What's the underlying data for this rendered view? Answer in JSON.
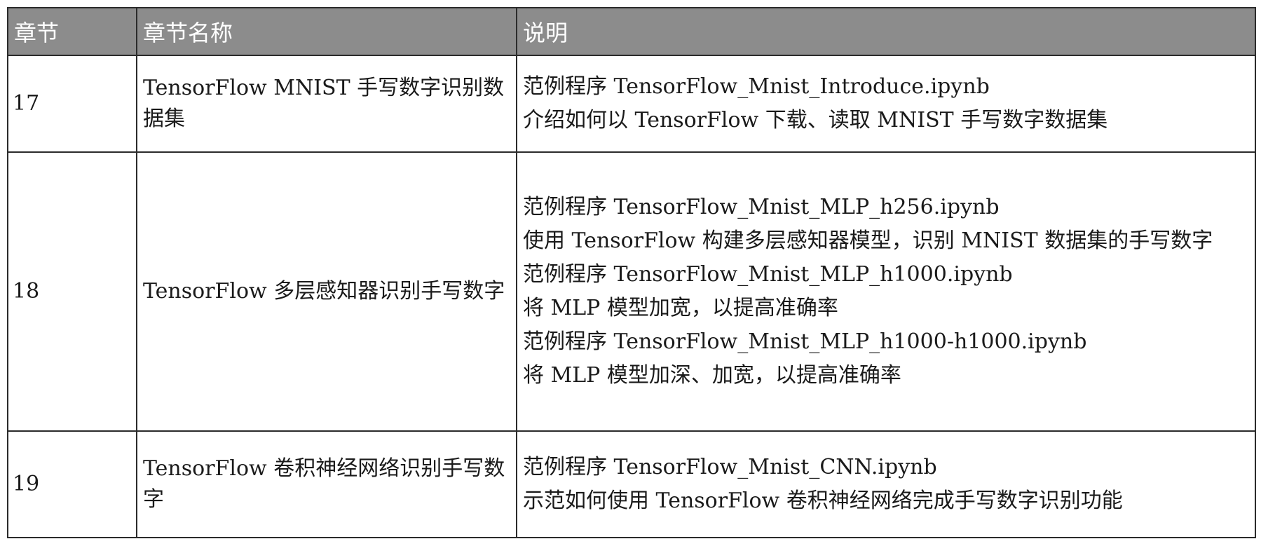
{
  "table": {
    "headers": [
      "章节",
      "章节名称",
      "说明"
    ],
    "rows": [
      {
        "chapter": "17",
        "name": "TensorFlow MNIST 手写数字识别数据集",
        "description": [
          "范例程序 TensorFlow_Mnist_Introduce.ipynb",
          "介绍如何以 TensorFlow 下载、读取 MNIST 手写数字数据集"
        ]
      },
      {
        "chapter": "18",
        "name": "TensorFlow 多层感知器识别手写数字",
        "description": [
          "范例程序 TensorFlow_Mnist_MLP_h256.ipynb",
          "使用 TensorFlow 构建多层感知器模型，识别 MNIST 数据集的手写数字",
          "范例程序 TensorFlow_Mnist_MLP_h1000.ipynb",
          "将 MLP 模型加宽，以提高准确率",
          "范例程序 TensorFlow_Mnist_MLP_h1000-h1000.ipynb",
          "将 MLP 模型加深、加宽，以提高准确率"
        ]
      },
      {
        "chapter": "19",
        "name": "TensorFlow 卷积神经网络识别手写数字",
        "description": [
          "范例程序 TensorFlow_Mnist_CNN.ipynb",
          "示范如何使用 TensorFlow 卷积神经网络完成手写数字识别功能"
        ]
      }
    ]
  }
}
